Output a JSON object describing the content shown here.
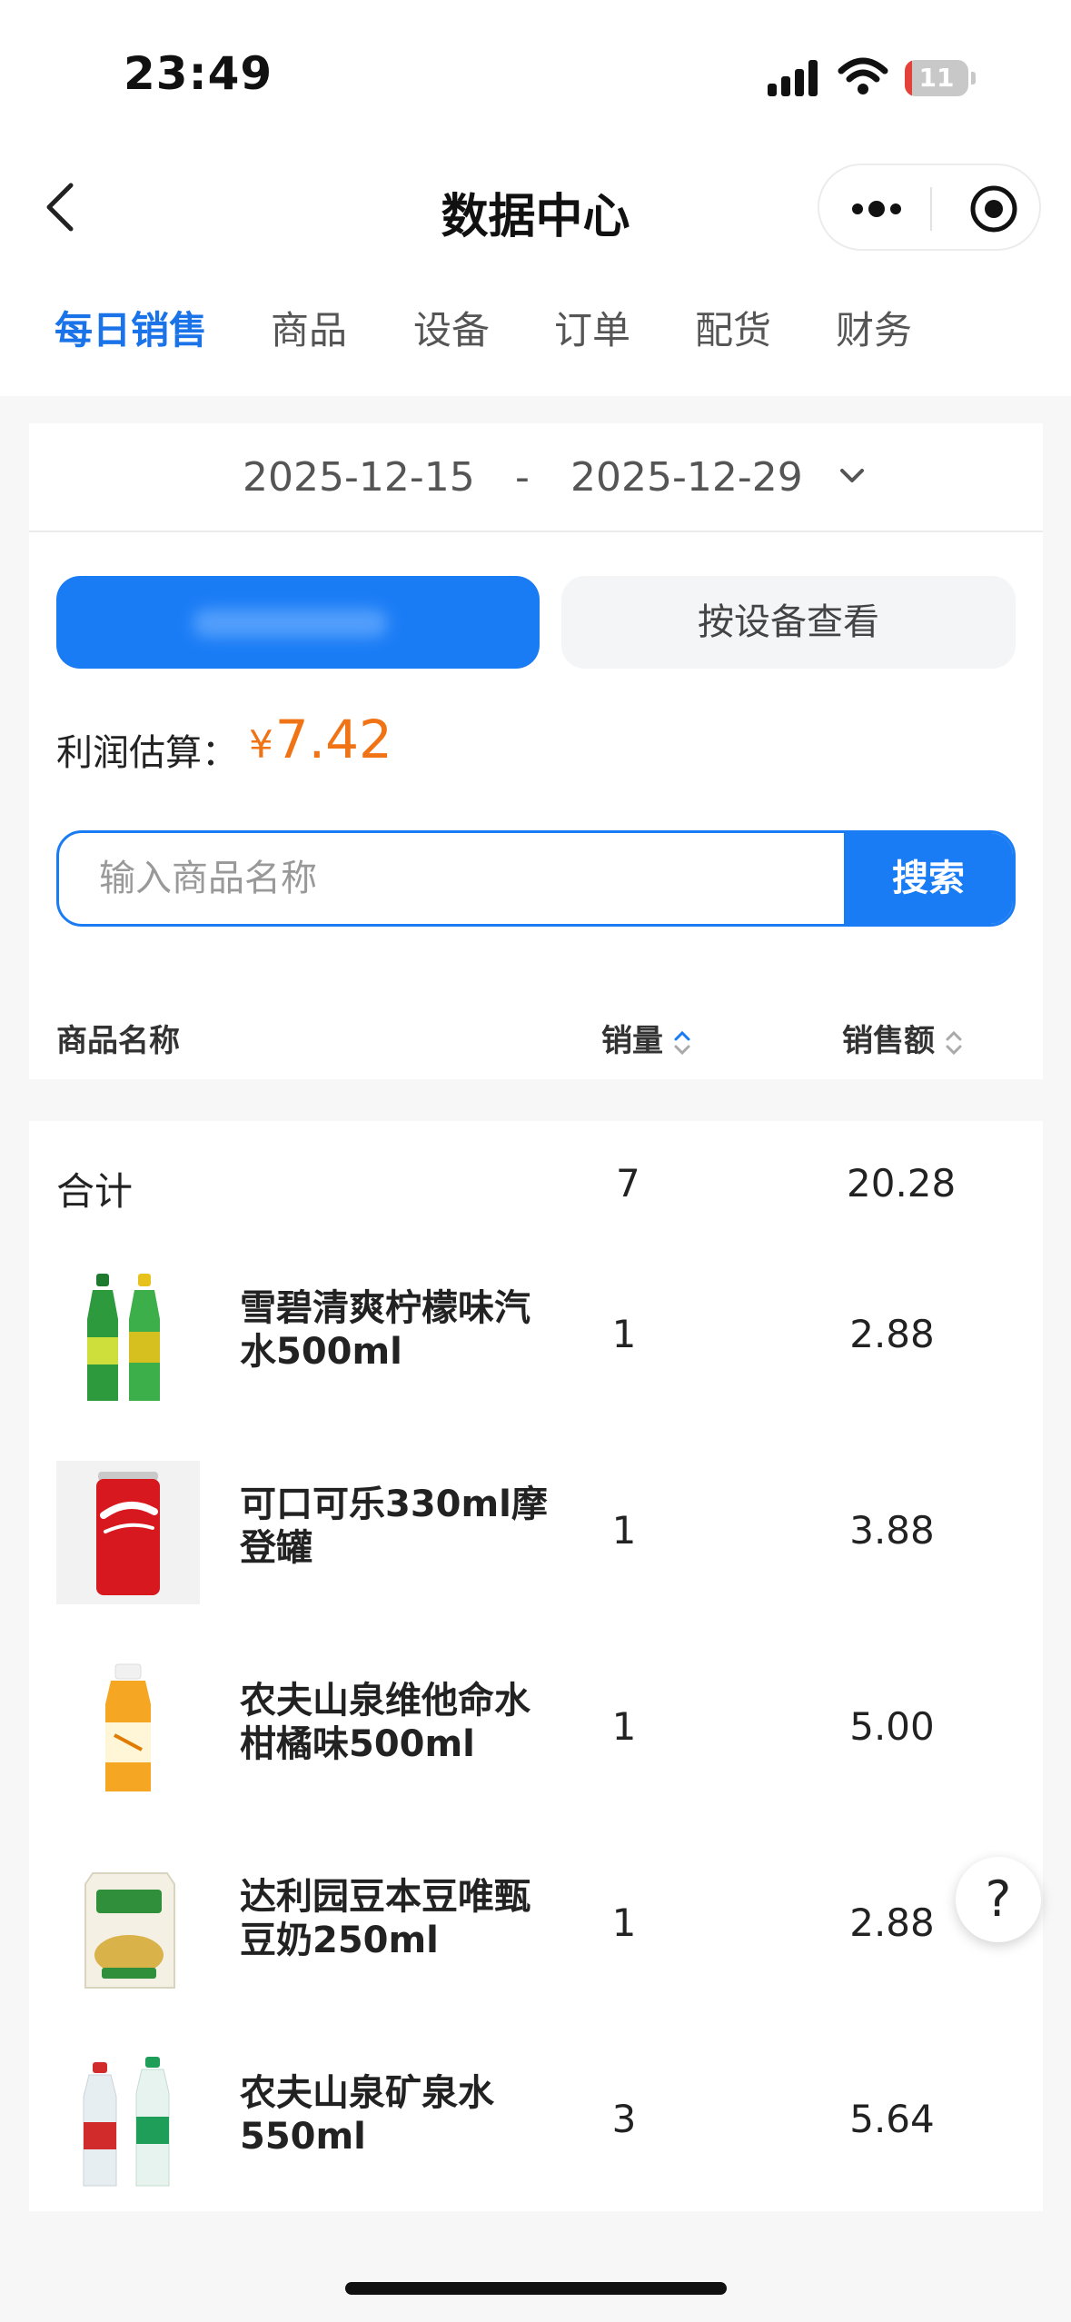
{
  "status_bar": {
    "time": "23:49",
    "battery": "11",
    "battery_level": 0.11
  },
  "nav": {
    "title": "数据中心"
  },
  "tabs": [
    {
      "label": "每日销售",
      "active": true
    },
    {
      "label": "商品",
      "active": false
    },
    {
      "label": "设备",
      "active": false
    },
    {
      "label": "订单",
      "active": false
    },
    {
      "label": "配货",
      "active": false
    },
    {
      "label": "财务",
      "active": false
    }
  ],
  "date_range": {
    "start": "2025-12-15",
    "separator": "-",
    "end": "2025-12-29"
  },
  "view_buttons": {
    "primary_label": "",
    "secondary_label": "按设备查看"
  },
  "profit": {
    "label": "利润估算：",
    "currency": "¥",
    "value": "7.42"
  },
  "search": {
    "placeholder": "输入商品名称",
    "button_label": "搜索"
  },
  "table": {
    "headers": {
      "name": "商品名称",
      "qty": "销量",
      "amount": "销售额"
    },
    "total": {
      "label": "合计",
      "qty": "7",
      "amount": "20.28"
    },
    "rows": [
      {
        "name": "雪碧清爽柠檬味汽水500ml",
        "qty": "1",
        "amount": "2.88",
        "icon": "sprite-bottles-icon"
      },
      {
        "name": "可口可乐330ml摩登罐",
        "qty": "1",
        "amount": "3.88",
        "icon": "coke-can-icon"
      },
      {
        "name": "农夫山泉维他命水柑橘味500ml",
        "qty": "1",
        "amount": "5.00",
        "icon": "vitamin-water-icon"
      },
      {
        "name": "达利园豆本豆唯甄豆奶250ml",
        "qty": "1",
        "amount": "2.88",
        "icon": "soy-milk-carton-icon"
      },
      {
        "name": "农夫山泉矿泉水550ml",
        "qty": "3",
        "amount": "5.64",
        "icon": "water-bottles-icon"
      }
    ]
  },
  "help": {
    "label": "?"
  },
  "colors": {
    "accent": "#1a7cf5",
    "tab_active": "#1a73e8",
    "profit": "#f07316",
    "battery_low": "#e5413b"
  }
}
